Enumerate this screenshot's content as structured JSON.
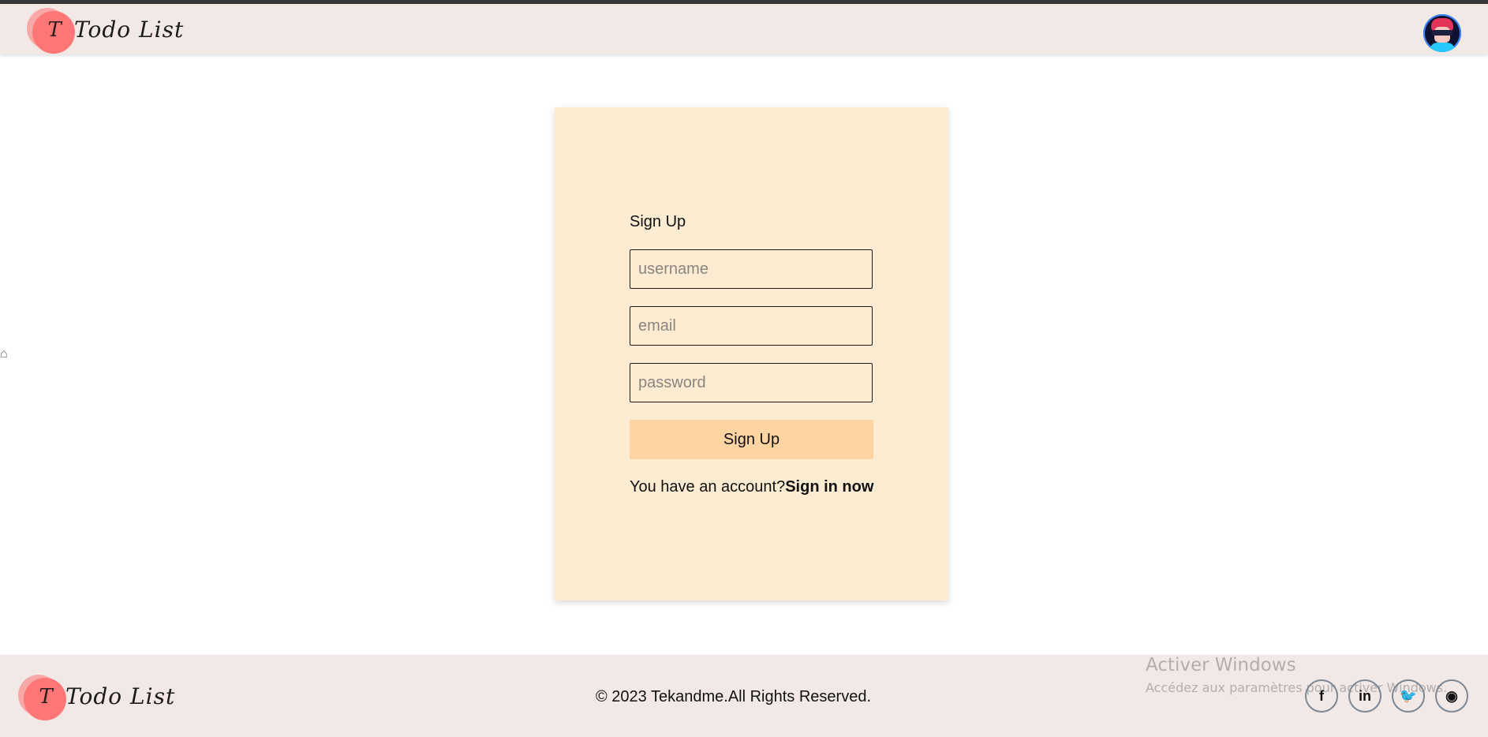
{
  "header": {
    "logo_letter": "T",
    "logo_text": "Todo List"
  },
  "form": {
    "title": "Sign Up",
    "username_placeholder": "username",
    "email_placeholder": "email",
    "password_placeholder": "password",
    "submit_label": "Sign Up",
    "account_prompt": "You have an account?",
    "signin_link": "Sign in now"
  },
  "footer": {
    "logo_letter": "T",
    "logo_text": "Todo List",
    "copyright": "© 2023 Tekandme.All Rights Reserved.",
    "social": [
      {
        "icon": "facebook-icon",
        "glyph": "f"
      },
      {
        "icon": "linkedin-icon",
        "glyph": "in"
      },
      {
        "icon": "twitter-icon",
        "glyph": "🐦"
      },
      {
        "icon": "github-icon",
        "glyph": "◉"
      }
    ]
  },
  "watermark": {
    "line1": "Activer Windows",
    "line2": "Accédez aux paramètres pour activer Windows."
  },
  "colors": {
    "header_bg": "#f2e9e7",
    "card_bg": "#fdebd2",
    "button_bg": "#ffd4a3",
    "logo_circle": "#ff7676"
  }
}
